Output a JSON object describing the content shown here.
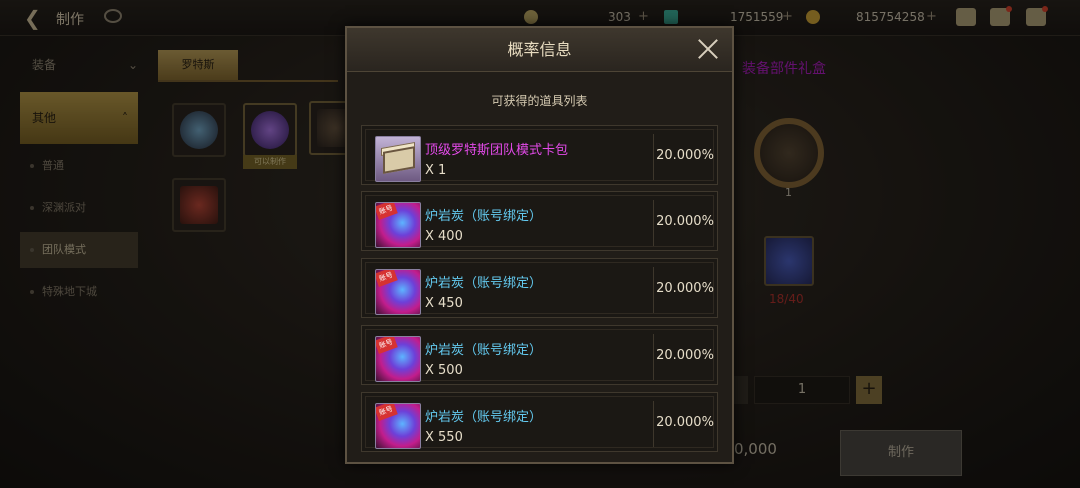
{
  "topbar": {
    "title": "制作",
    "currencies": [
      {
        "value": "303",
        "icon": "moon-icon",
        "color": "#c9b26a"
      },
      {
        "value": "1751559",
        "icon": "crystal-icon",
        "color": "#3fb6a0"
      },
      {
        "value": "815754258",
        "icon": "gold-coin-icon",
        "color": "#d6a93a"
      }
    ]
  },
  "sidebar": {
    "header": "装备",
    "selected_category": "其他",
    "items": [
      "普通",
      "深渊派对",
      "团队模式",
      "特殊地下城"
    ],
    "active_item": "团队模式"
  },
  "craft": {
    "tab": "罗特斯",
    "slot_tag": "可以制作",
    "target_title": "装备部件礼盒",
    "ring_count": "1",
    "material_count": "18/40",
    "quantity": "1",
    "price": "0,000",
    "make_label": "制作"
  },
  "modal": {
    "title": "概率信息",
    "subtitle": "可获得的道具列表",
    "items": [
      {
        "name": "顶级罗特斯团队模式卡包",
        "qty": "X 1",
        "rate": "20.000%",
        "icon": "card-pack-icon",
        "color": "#e34ae9"
      },
      {
        "name": "炉岩炭（账号绑定）",
        "qty": "X 400",
        "rate": "20.000%",
        "icon": "lava-coal-icon",
        "color": "#63c9ef"
      },
      {
        "name": "炉岩炭（账号绑定）",
        "qty": "X 450",
        "rate": "20.000%",
        "icon": "lava-coal-icon",
        "color": "#63c9ef"
      },
      {
        "name": "炉岩炭（账号绑定）",
        "qty": "X 500",
        "rate": "20.000%",
        "icon": "lava-coal-icon",
        "color": "#63c9ef"
      },
      {
        "name": "炉岩炭（账号绑定）",
        "qty": "X 550",
        "rate": "20.000%",
        "icon": "lava-coal-icon",
        "color": "#63c9ef"
      }
    ],
    "coal_tag": "账号"
  }
}
